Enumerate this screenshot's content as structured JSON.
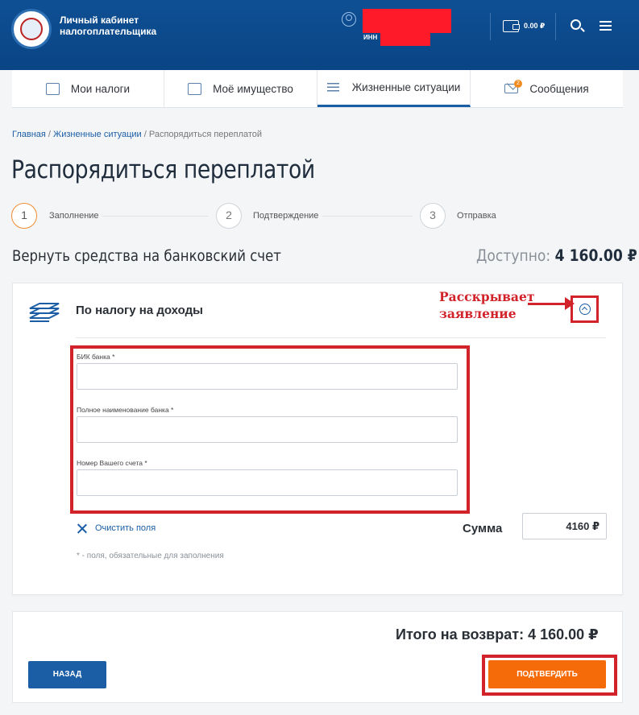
{
  "header": {
    "brand_line1": "Личный кабинет",
    "brand_line2": "налогоплательщика",
    "inn_label": "ИНН",
    "balance": "0.00 ₽",
    "icons": [
      "emblem-logo",
      "user-icon",
      "wallet-icon",
      "search-icon",
      "menu-icon"
    ]
  },
  "nav": {
    "tabs": [
      {
        "label": "Мои налоги",
        "icon": "taxes-icon"
      },
      {
        "label": "Моё имущество",
        "icon": "property-icon"
      },
      {
        "label": "Жизненные ситуации",
        "icon": "list-icon",
        "active": true
      },
      {
        "label": "Сообщения",
        "icon": "mail-icon",
        "badge": "2"
      }
    ]
  },
  "breadcrumb": {
    "home": "Главная",
    "sep": " / ",
    "section": "Жизненные ситуации",
    "current": "Распорядиться переплатой"
  },
  "page_title": "Распорядиться переплатой",
  "steps": [
    {
      "num": "1",
      "label": "Заполнение",
      "active": true
    },
    {
      "num": "2",
      "label": "Подтверждение"
    },
    {
      "num": "3",
      "label": "Отправка"
    }
  ],
  "subtitle": "Вернуть средства на банковский счет",
  "available": {
    "label": "Доступно:",
    "value": "4 160.00 ₽"
  },
  "card": {
    "title": "По налогу на доходы",
    "annotation_line1": "Расскрывает",
    "annotation_line2": "заявление",
    "fields": [
      {
        "label": "БИК банка *",
        "value": ""
      },
      {
        "label": "Полное наименование банка *",
        "value": ""
      },
      {
        "label": "Номер Вашего счета *",
        "value": ""
      }
    ],
    "clear_label": "Очистить поля",
    "sum_label": "Сумма",
    "sum_value": "4160 ₽",
    "required_note": "* - поля, обязательные для заполнения"
  },
  "footer": {
    "total": "Итого на возврат: 4 160.00 ₽",
    "back_label": "НАЗАД",
    "confirm_label": "ПОДТВЕРДИТЬ"
  },
  "colors": {
    "header_bg": "#0e4f93",
    "primary": "#1b5ea6",
    "confirm": "#f56b09",
    "annotation": "#d2232a"
  }
}
